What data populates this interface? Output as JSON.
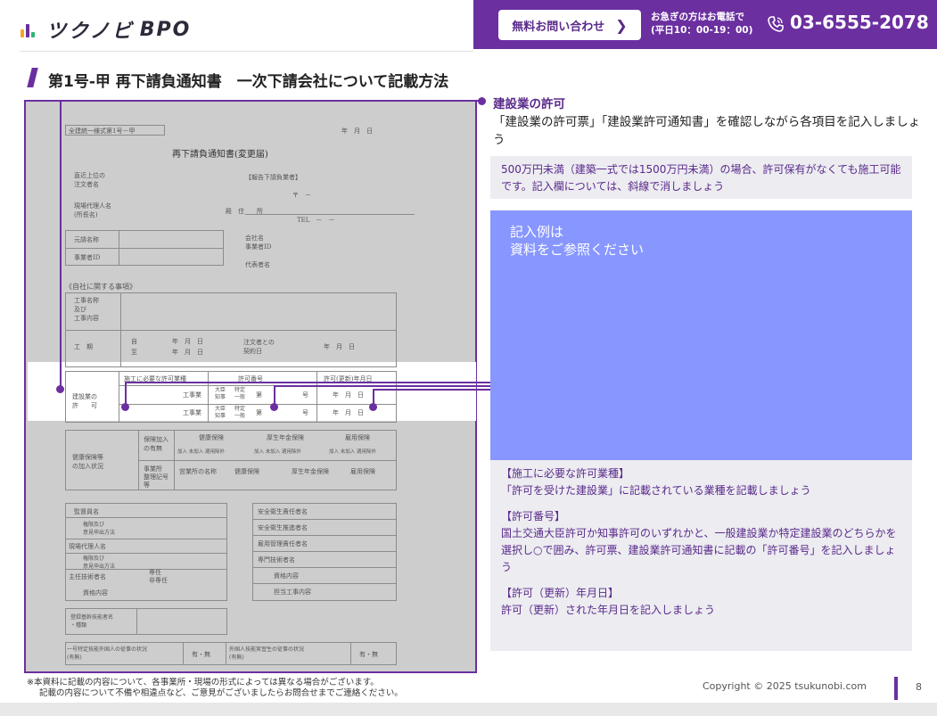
{
  "header": {
    "logo_text": "ツクノビ",
    "logo_bpo": "BPO",
    "cta_button": "無料お問い合わせ",
    "cta_note_line1": "お急ぎの方はお電話で",
    "cta_note_line2": "(平日10：00-19：00)",
    "phone": "03-6555-2078"
  },
  "page_title": "第1号-甲 再下請負通知書　一次下請会社について記載方法",
  "section": {
    "heading": "建設業の許可",
    "description": "「建設業の許可票」「建設業許可通知書」を確認しながら各項目を記入しましょう",
    "note": "500万円未満（建築一式では1500万円未満）の場合、許可保有がなくても施工可能です。記入欄については、斜線で消しましょう",
    "example_line1": "記入例は",
    "example_line2": "資料をご参照ください",
    "details": [
      {
        "label": "【施工に必要な許可業種】",
        "text": "「許可を受けた建設業」に記載されている業種を記載しましょう"
      },
      {
        "label": "【許可番号】",
        "text": "国土交通大臣許可か知事許可のいずれかと、一般建設業か特定建設業のどちらかを選択し○で囲み、許可票、建設業許可通知書に記載の「許可番号」を記入しましょう"
      },
      {
        "label": "【許可（更新）年月日】",
        "text": "許可（更新）された年月日を記入しましょう"
      }
    ]
  },
  "document": {
    "form_code": "全建統一様式第1号－甲",
    "date_label": "年　月　日",
    "form_title": "再下請負通知書(変更届)",
    "rows": {
      "orderer": "直近上位の\n注文者名",
      "site_agent": "現場代理人名\n(所長名)",
      "report_party": "【報告下請負業者】",
      "postal": "〒　－",
      "address": "殿　住　　所",
      "tel": "TEL　－　－",
      "original_name": "元請名称",
      "business_id": "事業者ID",
      "company": "会社名",
      "company_id": "事業者ID",
      "representative": "代表者名",
      "own_matters": "《自社に関する事項》",
      "work_name": "工事名称\n及び\n工事内容",
      "term": "工　期",
      "term_from": "自",
      "term_to": "至",
      "ymd": "年　月　日",
      "contract_date": "注文者との\n契約日",
      "license_row": "建設業の\n許　　可",
      "license_col1": "施工に必要な許可業種",
      "license_col2": "許可番号",
      "license_col3": "許可(更新)年月日",
      "work_type": "工事業",
      "minister": "大臣\n知事",
      "special": "特定\n一般",
      "dai": "第",
      "go": "号",
      "insurance": "健康保険等\nの加入状況",
      "ins_status": "保険加入\nの有無",
      "health": "健康保険",
      "pension": "厚生年金保険",
      "employment": "雇用保険",
      "join": "加入 未加入 適用除外",
      "office_no": "事業所\n整理記号\n等",
      "office_name": "営業所の名称",
      "supervisor": "監督員名",
      "authority": "権限及び\n意見申出方法",
      "site_agent2": "現場代理人名",
      "chief_engineer": "主任技術者名",
      "full_time": "専任\n非専任",
      "qualification": "資格内容",
      "safety_head": "安全衛生責任者名",
      "safety_promoter": "安全衛生推進者名",
      "employment_manager": "雇用管理責任者名",
      "specialist": "専門技術者名",
      "assigned_work": "担当工事内容",
      "core_engineer": "登録基幹技能者名\n・種類",
      "foreign_1": "一号特定技能外国人の従事の状況\n(有無)",
      "foreign_2": "外国人技能実習生の従事の状況\n(有無)",
      "yesno": "有・無"
    }
  },
  "footer": {
    "note_line1": "※本資料に記載の内容について、各事業所・現場の形式によっては異なる場合がございます。",
    "note_line2": "記載の内容について不備や相違点など、ご意見がございましたらお問合せまでご連絡ください。",
    "copyright": "Copyright © 2025 tsukunobi.com",
    "page_number": "8"
  },
  "colors": {
    "brand_purple": "#6b2fa0",
    "example_blue": "#8797ff",
    "note_bg": "#ececf1"
  }
}
